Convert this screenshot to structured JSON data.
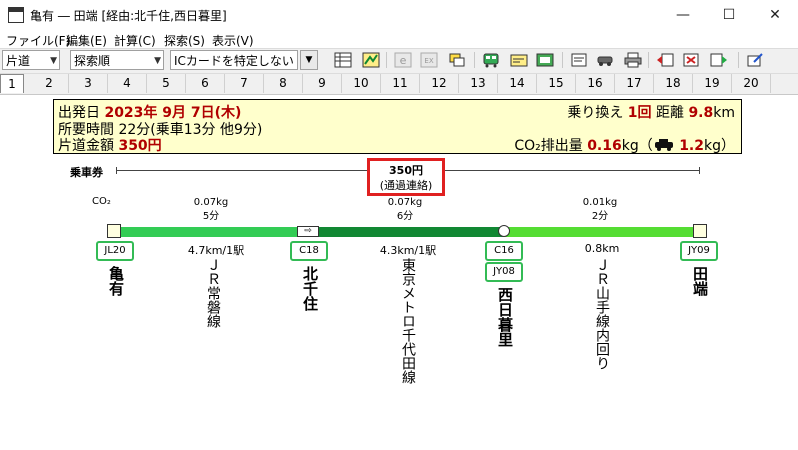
{
  "window": {
    "title": "亀有 ― 田端 [経由:北千住,西日暮里]",
    "minimize": "—",
    "maximize": "☐",
    "close": "✕"
  },
  "menu": [
    "ファイル(F)",
    "編集(E)",
    "計算(C)",
    "探索(S)",
    "表示(V)"
  ],
  "toolbar": {
    "trip_type": "片道",
    "search_order": "探索順",
    "ic_card": "ICカードを特定しない",
    "icons": [
      "table-icon",
      "map-icon",
      "e-icon",
      "ex-icon",
      "route-icon",
      "train-icon",
      "pass-icon",
      "station-icon",
      "memo-icon",
      "car-icon",
      "printer-icon",
      "prev-icon",
      "transfer-icon",
      "next-icon",
      "edit-icon"
    ]
  },
  "tabs": [
    "1",
    "2",
    "3",
    "4",
    "5",
    "6",
    "7",
    "8",
    "9",
    "10",
    "11",
    "12",
    "13",
    "14",
    "15",
    "16",
    "17",
    "18",
    "19",
    "20"
  ],
  "summary": {
    "depart_label": "出発日",
    "depart_value": "2023年 9月 7日(木)",
    "time_label": "所要時間",
    "time_value": "22分",
    "time_detail": "(乗車13分 他9分)",
    "fare_label": "片道金額",
    "fare_value": "350円",
    "transfer_label": "乗り換え",
    "transfer_value": "1回",
    "distance_label": "距離",
    "distance_value": "9.8",
    "distance_unit": "km",
    "co2_label": "CO₂排出量",
    "co2_value": "0.16",
    "co2_unit": "kg",
    "car_value": "1.2",
    "car_unit": "kg"
  },
  "ticket": {
    "label": "乗車券",
    "fare": "350円",
    "note": "(通過連絡)"
  },
  "co2_row_label": "CO₂",
  "segments": [
    {
      "co2": "0.07kg",
      "time": "5分",
      "dist": "4.7km/1駅",
      "line": "ＪＲ常磐線",
      "color": "#33cc55"
    },
    {
      "co2": "0.07kg",
      "time": "6分",
      "dist": "4.3km/1駅",
      "line": "東京メトロ千代田線",
      "color": "#118833"
    },
    {
      "co2": "0.01kg",
      "time": "2分",
      "dist": "0.8km",
      "line": "ＪＲ山手線内回り",
      "color": "#55dd33"
    }
  ],
  "stations": [
    {
      "name": "亀有",
      "codes": [
        "JL20"
      ]
    },
    {
      "name": "北千住",
      "codes": [
        "C18"
      ]
    },
    {
      "name": "西日暮里",
      "codes": [
        "C16",
        "JY08"
      ]
    },
    {
      "name": "田端",
      "codes": [
        "JY09"
      ]
    }
  ]
}
